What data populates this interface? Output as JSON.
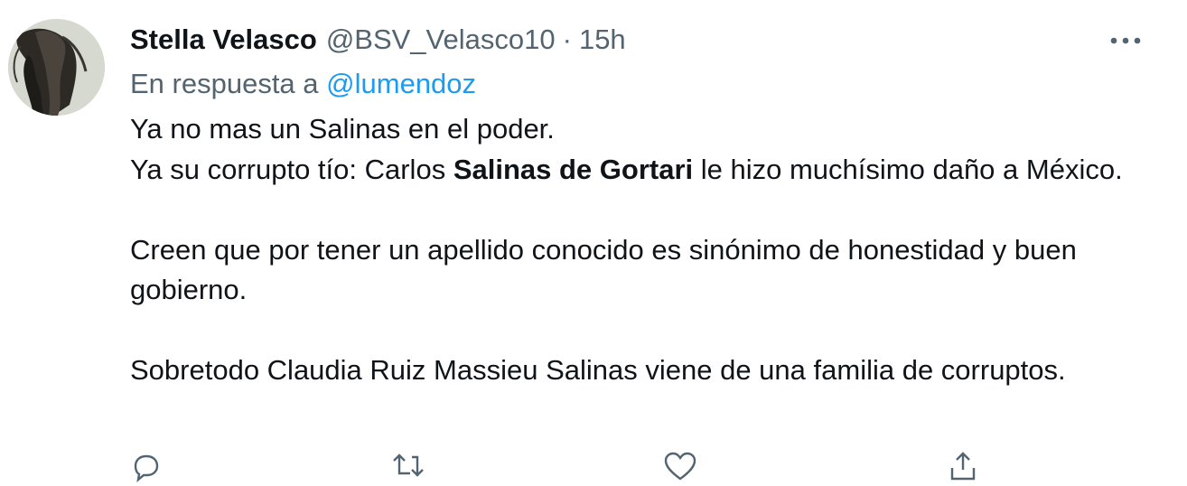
{
  "tweet": {
    "author": {
      "display_name": "Stella Velasco",
      "handle": "@BSV_Velasco10",
      "separator": "·",
      "time": "15h",
      "avatar_icon": "avatar-photo"
    },
    "reply": {
      "prefix": "En respuesta a",
      "mention": "@lumendoz"
    },
    "body": {
      "line1": "Ya no mas un Salinas en el poder.",
      "line2_before": "Ya su corrupto tío: Carlos ",
      "line2_bold": "Salinas de Gortari",
      "line2_after": " le hizo muchísimo daño a México.",
      "paragraph2": "Creen que por tener un apellido conocido es sinónimo de honestidad y buen gobierno.",
      "paragraph3": "Sobretodo Claudia Ruiz Massieu Salinas viene de una familia de corruptos."
    },
    "more_icon": "more-horizontal-icon",
    "actions": [
      {
        "name": "reply",
        "icon": "reply-icon"
      },
      {
        "name": "retweet",
        "icon": "retweet-icon"
      },
      {
        "name": "like",
        "icon": "heart-icon"
      },
      {
        "name": "share",
        "icon": "share-icon"
      }
    ],
    "colors": {
      "text": "#0f1419",
      "secondary": "#536471",
      "link": "#1d9bf0"
    }
  }
}
